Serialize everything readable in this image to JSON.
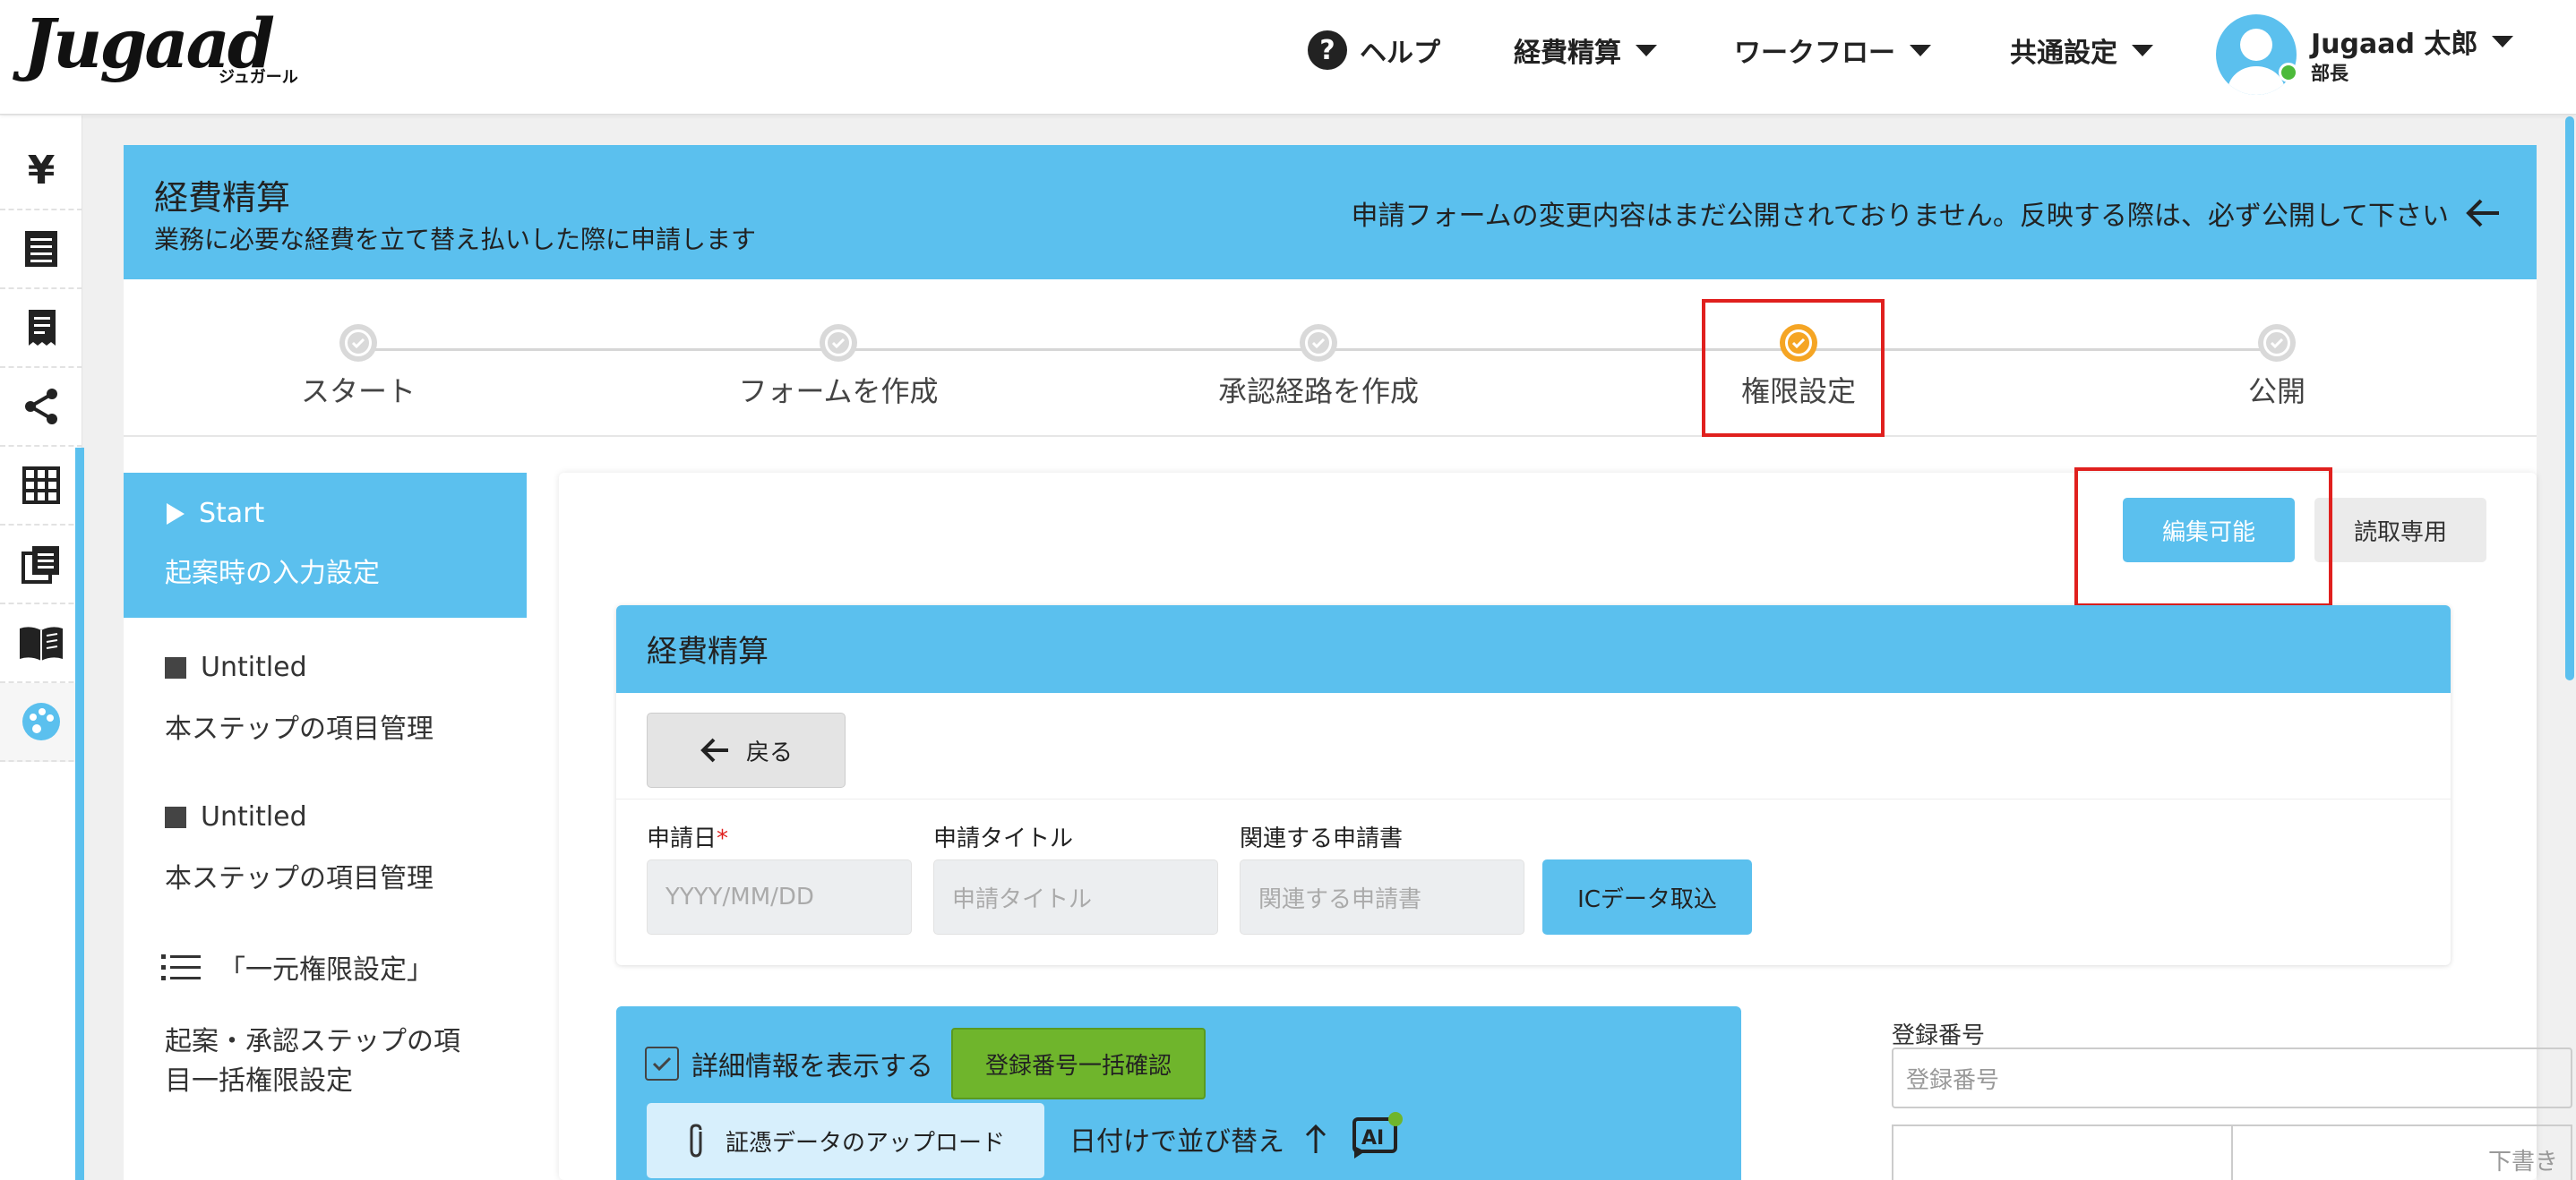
{
  "header": {
    "logo": "Jugaad",
    "logo_sub": "ジュガール",
    "help": "ヘルプ",
    "nav": [
      "経費精算",
      "ワークフロー",
      "共通設定"
    ],
    "user_name": "Jugaad 太郎",
    "user_role": "部長"
  },
  "rail_icons": [
    "yen-icon",
    "document-list-icon",
    "receipt-icon",
    "share-icon",
    "grid-icon",
    "copy-list-icon",
    "book-icon",
    "palette-icon"
  ],
  "banner": {
    "title": "経費精算",
    "subtitle": "業務に必要な経費を立て替え払いした際に申請します",
    "notice": "申請フォームの変更内容はまだ公開されておりません。反映する際は、必ず公開して下さい"
  },
  "stepper": {
    "steps": [
      "スタート",
      "フォームを作成",
      "承認経路を作成",
      "権限設定",
      "公開"
    ],
    "active_index": 3,
    "active_color": "#f5a524"
  },
  "side": {
    "active": {
      "title": "Start",
      "sub": "起案時の入力設定"
    },
    "items": [
      {
        "title": "Untitled",
        "sub": "本ステップの項目管理"
      },
      {
        "title": "Untitled",
        "sub": "本ステップの項目管理"
      }
    ],
    "bulk": {
      "title": "「一元権限設定」",
      "sub_line1": "起案・承認ステップの項",
      "sub_line2": "目一括権限設定"
    }
  },
  "permission_buttons": {
    "edit": "編集可能",
    "read": "読取専用"
  },
  "form": {
    "title": "経費精算",
    "back": "戻る",
    "fields": [
      {
        "label": "申請日",
        "required_mark": "*",
        "placeholder": "YYYY/MM/DD"
      },
      {
        "label": "申請タイトル",
        "placeholder": "申請タイトル"
      },
      {
        "label": "関連する申請書",
        "placeholder": "関連する申請書"
      }
    ],
    "ic_button": "ICデータ取込"
  },
  "detail": {
    "show_details": "詳細情報を表示する",
    "bulk_check": "登録番号一括確認",
    "upload": "証憑データのアップロード",
    "sort": "日付けで並び替え"
  },
  "registration": {
    "label": "登録番号",
    "placeholder": "登録番号",
    "draft": "下書き"
  },
  "colors": {
    "accent": "#5bc0ee",
    "highlight": "#e0201e",
    "green": "#6fb52c"
  }
}
